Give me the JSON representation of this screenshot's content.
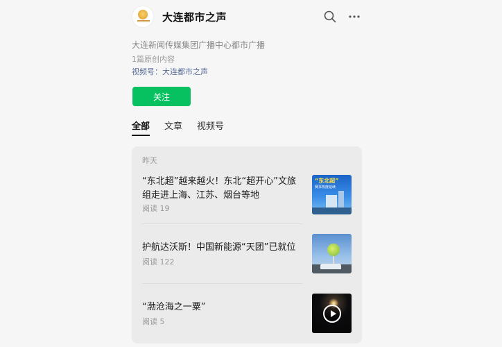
{
  "account": {
    "name": "大连都市之声",
    "description": "大连新闻传媒集团广播中心都市广播",
    "original_count": "1篇原创内容",
    "channel_label": "视频号：",
    "channel_name": "大连都市之声",
    "follow_label": "关注"
  },
  "icons": {
    "search": "search-icon",
    "more": "more-icon"
  },
  "tabs": [
    {
      "label": "全部",
      "active": true
    },
    {
      "label": "文章",
      "active": false
    },
    {
      "label": "视频号",
      "active": false
    }
  ],
  "feed": {
    "date_label": "昨天",
    "items": [
      {
        "title": "“东北超”越来越火！东北“超开心”文旅组走进上海、江苏、烟台等地",
        "reads": "阅读 19",
        "thumb_text_1": "“东北超”",
        "thumb_text_2": "赛事热度延续"
      },
      {
        "title": "护航达沃斯！中国新能源“天团”已就位",
        "reads": "阅读 122"
      },
      {
        "title": "“渤沧海之一粟”",
        "reads": "阅读 5"
      }
    ]
  },
  "colors": {
    "accent": "#07c160",
    "link": "#576b95",
    "background": "#f6f6f7",
    "card": "#ebebec"
  }
}
